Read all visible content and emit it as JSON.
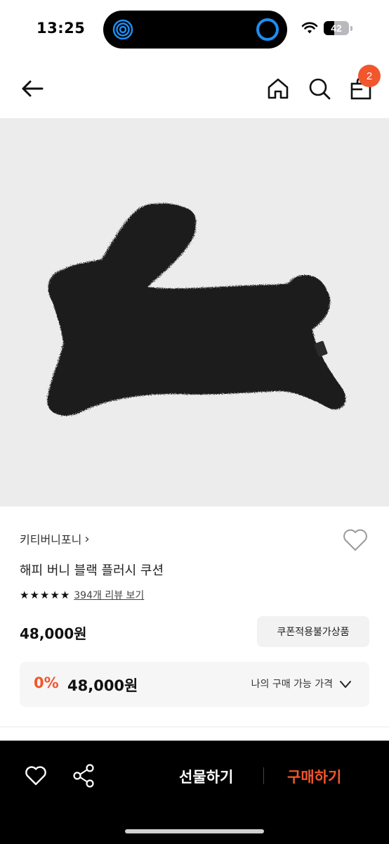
{
  "status_bar": {
    "time": "13:25",
    "battery": "42",
    "battery_level": 0.42
  },
  "nav": {
    "back_icon": "arrow-left-icon",
    "home_icon": "home-icon",
    "search_icon": "search-icon",
    "bag_icon": "shopping-bag-icon",
    "cart_count": "2"
  },
  "product": {
    "brand": "키티버니포니",
    "brand_chevron": "›",
    "name": "해피 버니 블랙 플러시 쿠션",
    "rating_stars": 5,
    "review_link": "394개 리뷰 보기",
    "price": "48,000원",
    "coupon_button": "쿠폰적용불가상품",
    "my_price": {
      "discount": "0%",
      "price": "48,000원",
      "label": "나의 구매 가능 가격"
    }
  },
  "bottom_bar": {
    "wish_icon": "heart-outline-icon",
    "share_icon": "share-icon",
    "gift_label": "선물하기",
    "buy_label": "구매하기"
  },
  "colors": {
    "accent": "#f2562c",
    "image_bg": "#ececec",
    "bottom_bar_bg": "#000000"
  }
}
